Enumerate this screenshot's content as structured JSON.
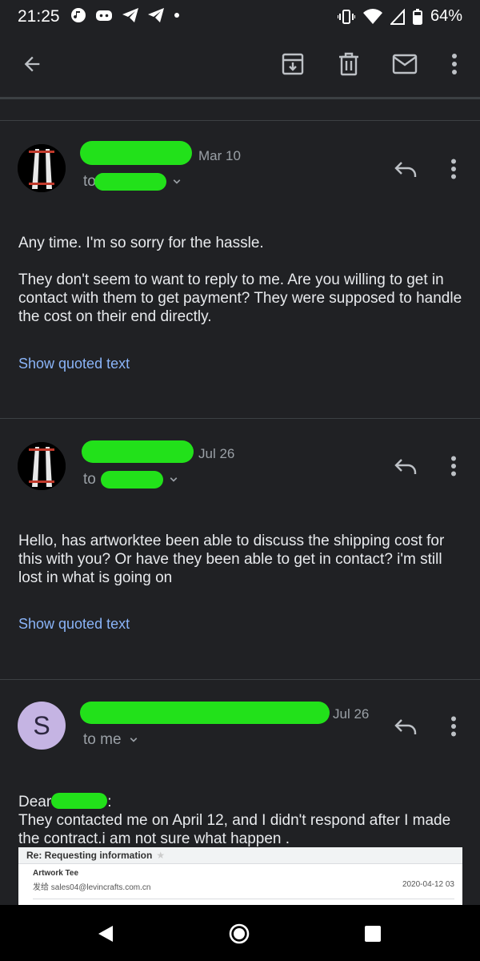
{
  "status_bar": {
    "time": "21:25",
    "battery": "64%"
  },
  "toolbar": {
    "back": "back-arrow-icon",
    "archive": "archive-icon",
    "delete": "trash-icon",
    "mark_unread": "mail-icon",
    "more": "more-vert-icon"
  },
  "messages": [
    {
      "date": "Mar 10",
      "to_prefix": "to",
      "body": [
        "Any time. I'm so sorry for the hassle.",
        "They don't seem to want to reply to me. Are you willing to get in contact with them to get payment? They were supposed to handle the cost on their end directly."
      ],
      "show_quoted": "Show quoted text"
    },
    {
      "date": "Jul 26",
      "to_prefix": "to",
      "body": [
        "Hello, has artworktee been able to discuss the shipping cost for this with you? Or have they been able to get in contact? i'm still lost in what is going on"
      ],
      "show_quoted": "Show quoted text"
    },
    {
      "date": "Jul 26",
      "avatar_letter": "S",
      "to_line": "to me",
      "greeting_prefix": "Dear",
      "greeting_suffix": ":",
      "body": [
        "They contacted me on April 12, and I didn't respond after I made the contract.i am not sure what happen ."
      ],
      "quoted_image": {
        "subject": "Re: Requesting information",
        "sender": "Artwork Tee",
        "sent_to_label": "发给",
        "sent_to": "sales04@levincrafts.com.cn",
        "date": "2020-04-12 03"
      }
    }
  ],
  "colors": {
    "background": "#202124",
    "link": "#8ab4f8",
    "redaction": "#22e11a",
    "avatar_s": "#c5b4e3"
  }
}
